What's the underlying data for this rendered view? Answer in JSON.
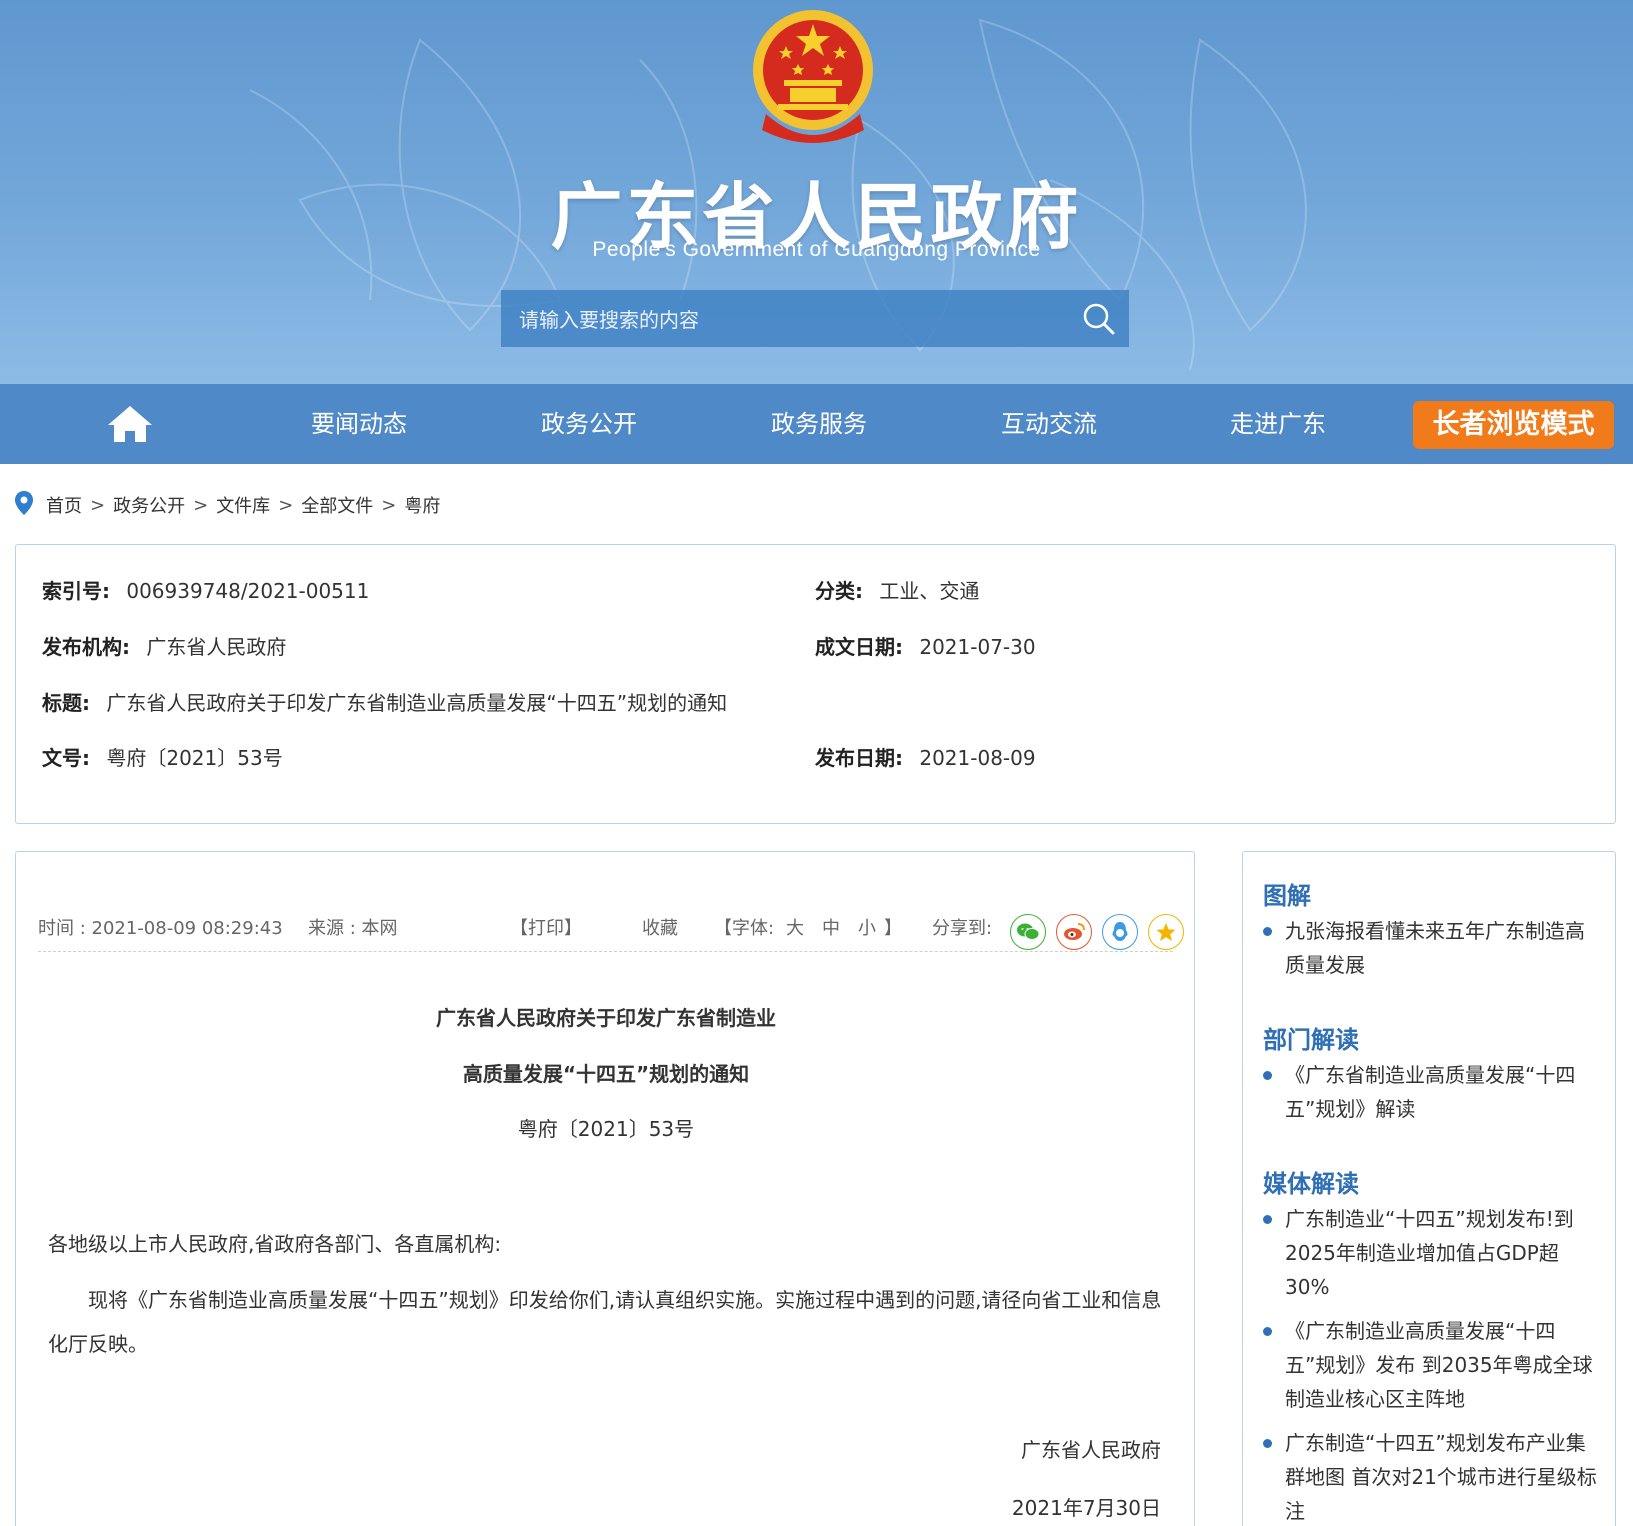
{
  "header": {
    "title": "广东省人民政府",
    "subtitle": "People's Government of Guangdong Province",
    "search_placeholder": "请输入要搜索的内容",
    "emblem_icon": "national-emblem-icon",
    "banner_color": "#6da3d7"
  },
  "nav": {
    "home_icon": "home-icon",
    "items": [
      "要闻动态",
      "政务公开",
      "政务服务",
      "互动交流",
      "走进广东"
    ],
    "elder_mode": "长者浏览模式",
    "elder_color": "#f17b1a"
  },
  "breadcrumb": {
    "icon": "location-pin-icon",
    "items": [
      "首页",
      "政务公开",
      "文件库",
      "全部文件",
      "粤府"
    ],
    "separator": ">"
  },
  "info": {
    "index_label": "索引号:",
    "index_value": "006939748/2021-00511",
    "category_label": "分类:",
    "category_value": "工业、交通",
    "issuer_label": "发布机构:",
    "issuer_value": "广东省人民政府",
    "written_date_label": "成文日期:",
    "written_date_value": "2021-07-30",
    "title_label": "标题:",
    "title_value": "广东省人民政府关于印发广东省制造业高质量发展“十四五”规划的通知",
    "doc_no_label": "文号:",
    "doc_no_value": "粤府〔2021〕53号",
    "publish_date_label": "发布日期:",
    "publish_date_value": "2021-08-09"
  },
  "article": {
    "time": "时间 : 2021-08-09 08:29:43",
    "source": "来源 : 本网",
    "print": "【打印】",
    "favorite": "收藏",
    "font_prefix": "【字体:",
    "font_large": "大",
    "font_medium": "中",
    "font_small": "小",
    "font_suffix": "】",
    "share_label": "分享到:",
    "share_icons": [
      "wechat-icon",
      "weibo-icon",
      "qq-icon",
      "qzone-icon"
    ],
    "title_line1": "广东省人民政府关于印发广东省制造业",
    "title_line2": "高质量发展“十四五”规划的通知",
    "doc_number": "粤府〔2021〕53号",
    "greeting": "各地级以上市人民政府,省政府各部门、各直属机构:",
    "body": "现将《广东省制造业高质量发展“十四五”规划》印发给你们,请认真组织实施。实施过程中遇到的问题,请径向省工业和信息化厅反映。",
    "signature": "广东省人民政府",
    "sign_date": "2021年7月30日"
  },
  "sidebar": {
    "sections": [
      {
        "heading": "图解",
        "items": [
          "九张海报看懂未来五年广东制造高质量发展"
        ]
      },
      {
        "heading": "部门解读",
        "items": [
          "《广东省制造业高质量发展“十四五”规划》解读"
        ]
      },
      {
        "heading": "媒体解读",
        "items": [
          "广东制造业“十四五”规划发布!到2025年制造业增加值占GDP超30%",
          "《广东制造业高质量发展“十四五”规划》发布 到2035年粤成全球制造业核心区主阵地",
          "广东制造“十四五”规划发布产业集群地图 首次对21个城市进行星级标注"
        ]
      }
    ],
    "accent_color": "#2f6fb5"
  }
}
